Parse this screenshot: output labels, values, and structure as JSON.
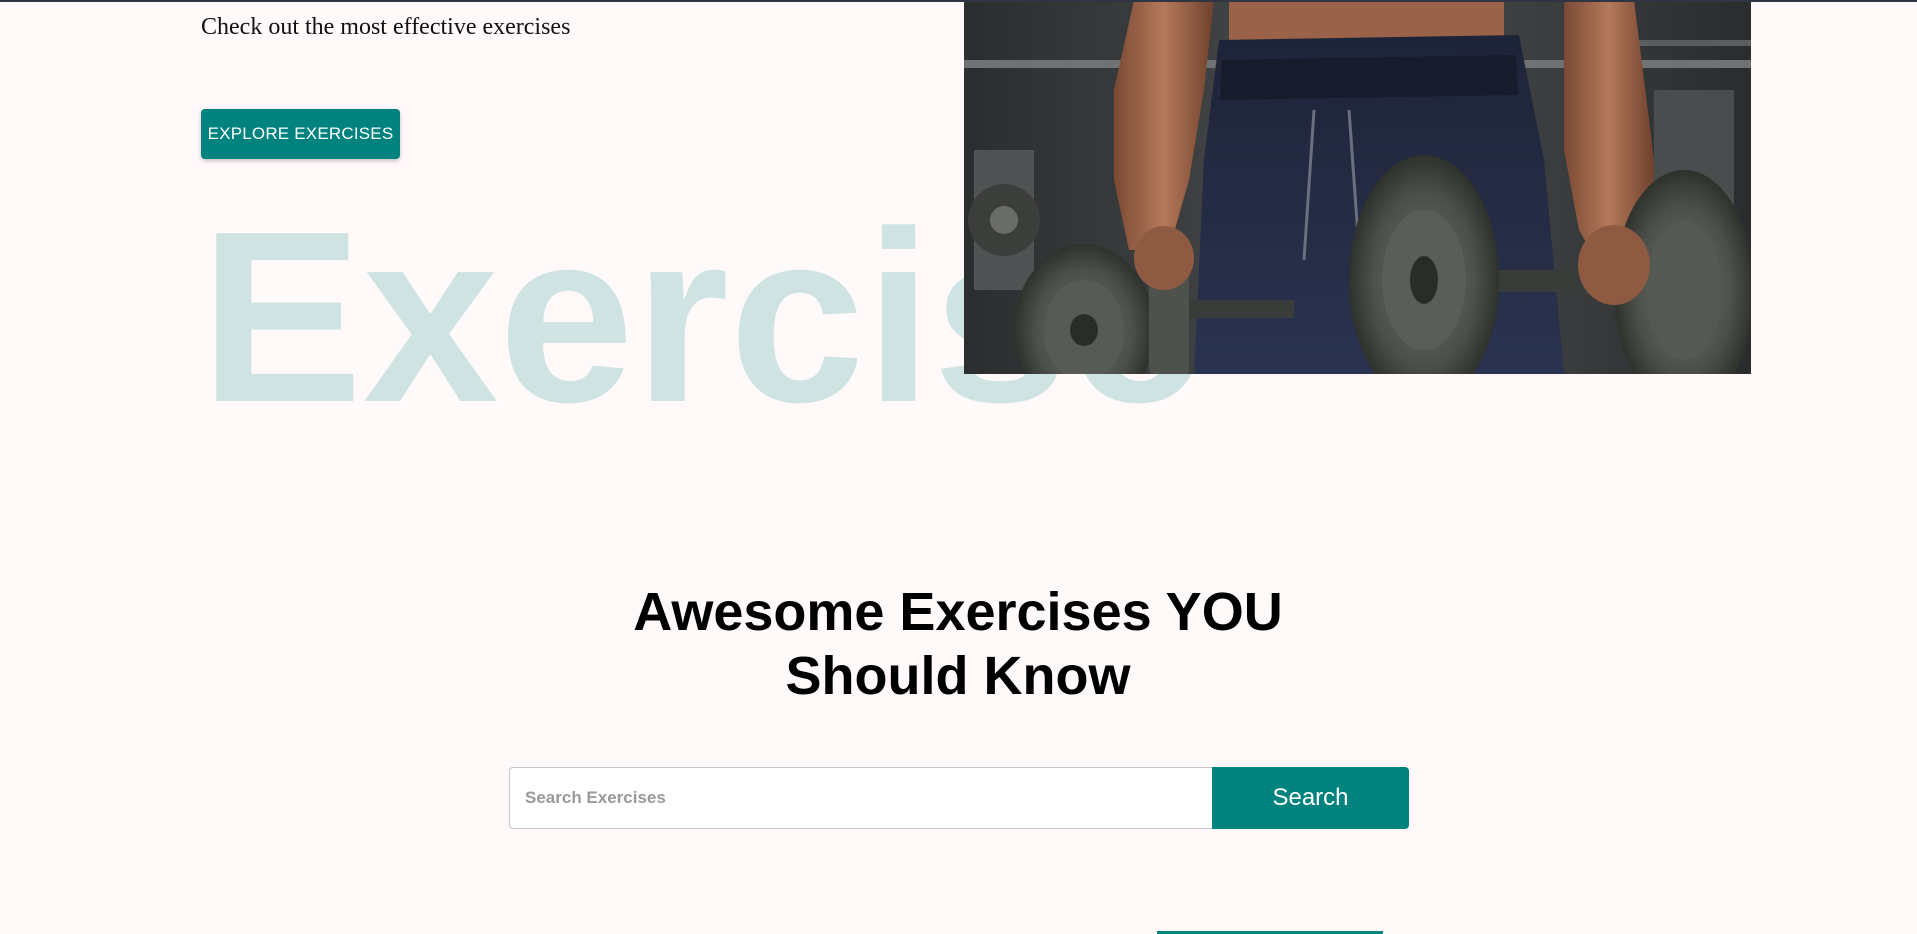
{
  "hero": {
    "subtitle": "Check out the most effective exercises",
    "cta_label": "EXPLORE EXERCISES",
    "background_word": "Exercise",
    "image_alt": "Man holding dumbbells"
  },
  "search_section": {
    "heading_line1": "Awesome Exercises YOU",
    "heading_line2": "Should Know",
    "input_placeholder": "Search Exercises",
    "input_value": "",
    "button_label": "Search"
  },
  "colors": {
    "accent": "#00837f",
    "page_background": "#fff9fa",
    "background_word_tint": "#cde3e3"
  }
}
